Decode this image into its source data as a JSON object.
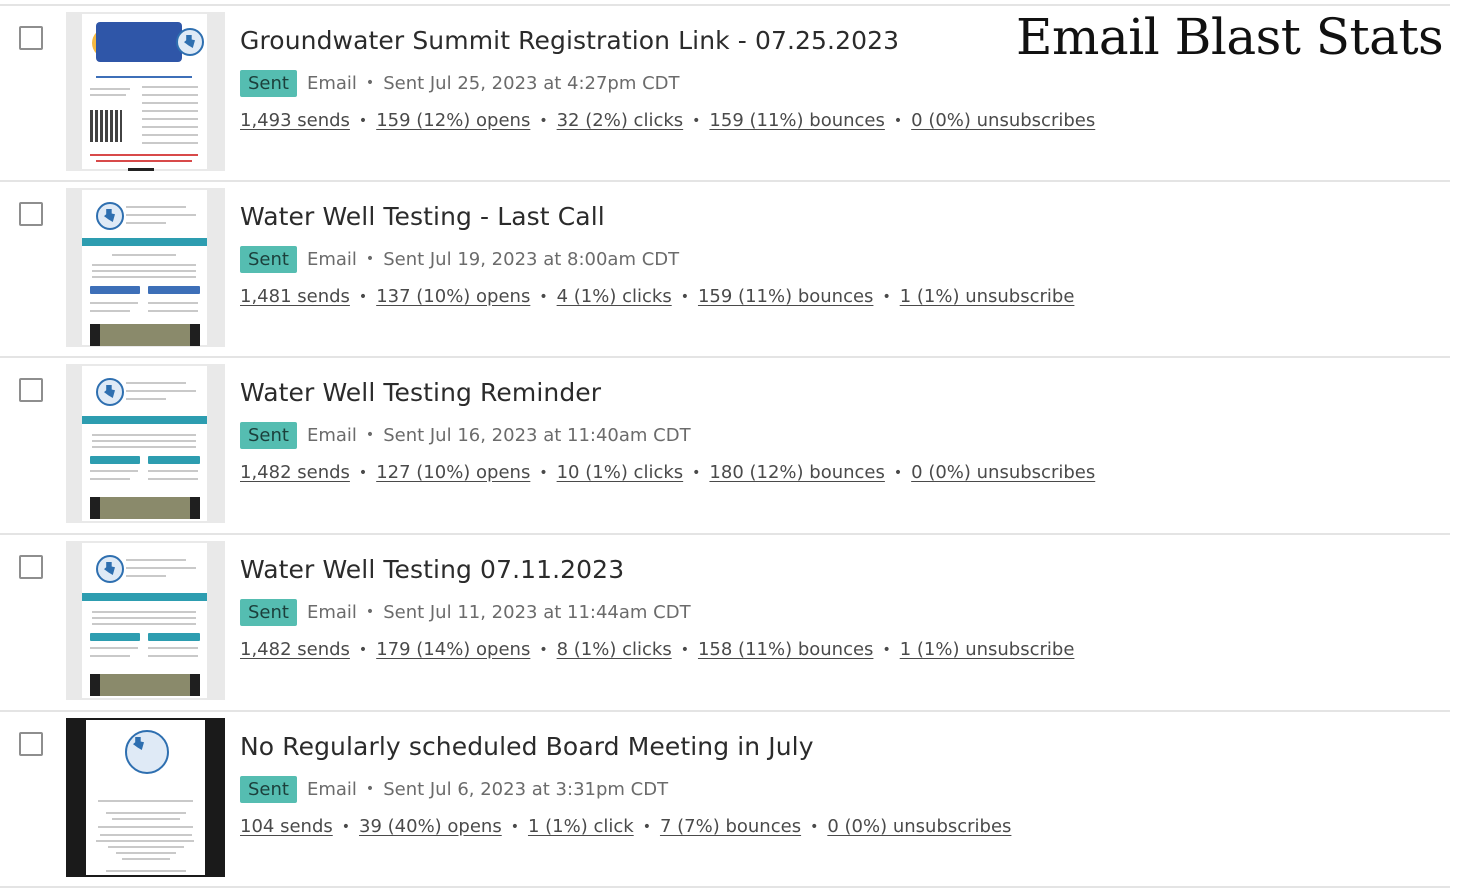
{
  "page_title": "Email Blast Stats",
  "campaigns": [
    {
      "name": "Groundwater Summit Registration Link - 07.25.2023",
      "status": "Sent",
      "type": "Email",
      "sent_at": "Sent Jul 25, 2023 at 4:27pm CDT",
      "stats": {
        "sends": "1,493 sends",
        "opens": "159 (12%) opens",
        "clicks": "32 (2%) clicks",
        "bounces": "159 (11%) bounces",
        "unsubscribes": "0 (0%) unsubscribes"
      }
    },
    {
      "name": "Water Well Testing - Last Call",
      "status": "Sent",
      "type": "Email",
      "sent_at": "Sent Jul 19, 2023 at 8:00am CDT",
      "stats": {
        "sends": "1,481 sends",
        "opens": "137 (10%) opens",
        "clicks": "4 (1%) clicks",
        "bounces": "159 (11%) bounces",
        "unsubscribes": "1 (1%) unsubscribe"
      }
    },
    {
      "name": "Water Well Testing Reminder",
      "status": "Sent",
      "type": "Email",
      "sent_at": "Sent Jul 16, 2023 at 11:40am CDT",
      "stats": {
        "sends": "1,482 sends",
        "opens": "127 (10%) opens",
        "clicks": "10 (1%) clicks",
        "bounces": "180 (12%) bounces",
        "unsubscribes": "0 (0%) unsubscribes"
      }
    },
    {
      "name": "Water Well Testing 07.11.2023",
      "status": "Sent",
      "type": "Email",
      "sent_at": "Sent Jul 11, 2023 at 11:44am CDT",
      "stats": {
        "sends": "1,482 sends",
        "opens": "179 (14%) opens",
        "clicks": "8 (1%) clicks",
        "bounces": "158 (11%) bounces",
        "unsubscribes": "1 (1%) unsubscribe"
      }
    },
    {
      "name": "No Regularly scheduled Board Meeting in July",
      "status": "Sent",
      "type": "Email",
      "sent_at": "Sent Jul 6, 2023 at 3:31pm CDT",
      "stats": {
        "sends": "104 sends",
        "opens": "39 (40%) opens",
        "clicks": "1 (1%) click",
        "bounces": "7 (7%) bounces",
        "unsubscribes": "0 (0%) unsubscribes"
      }
    }
  ],
  "colors": {
    "sent_badge": "#55bdb1",
    "divider": "#e4e4e4",
    "thumb_accent": "#2d9db0"
  },
  "icons": {
    "seal": "texas-seal-icon",
    "checkbox": "checkbox-icon"
  }
}
